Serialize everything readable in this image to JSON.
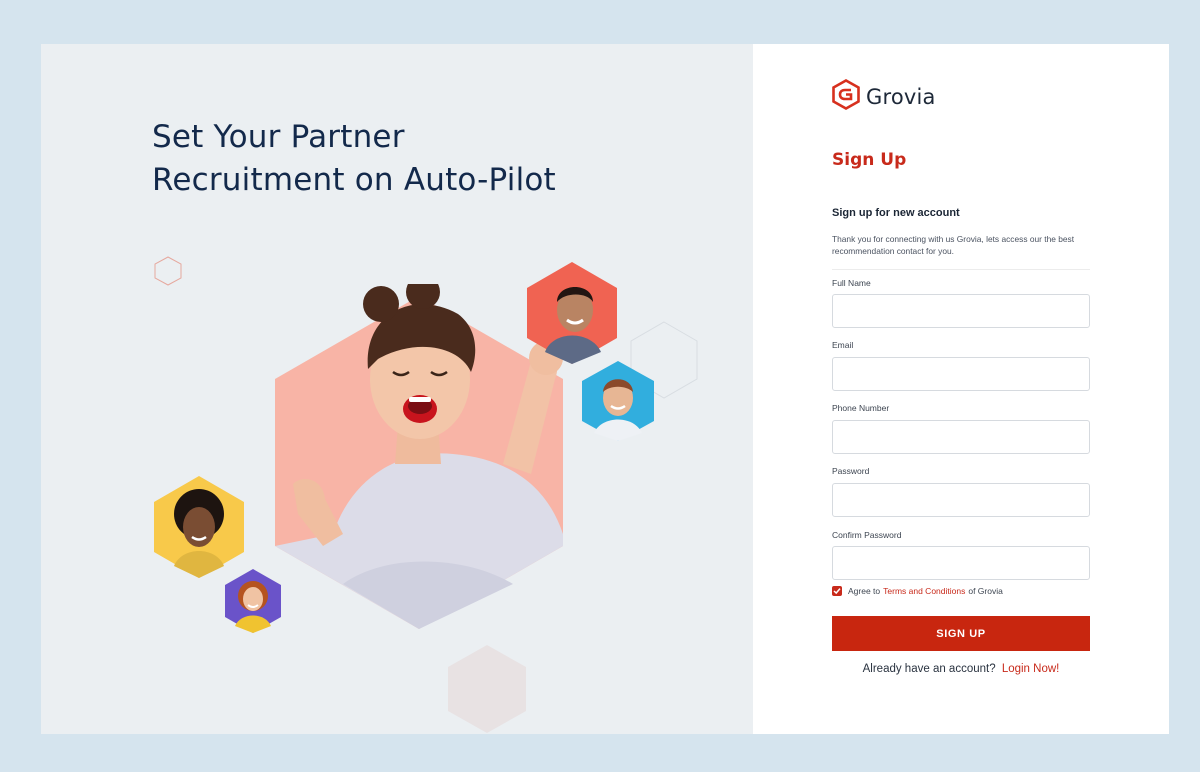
{
  "hero": {
    "headline_line1": "Set Your Partner",
    "headline_line2": "Recruitment on Auto-Pilot"
  },
  "brand": {
    "name": "Grovia",
    "accent_color": "#c82a1b",
    "logo_icon": "hexagon-logo-icon"
  },
  "form": {
    "title": "Sign Up",
    "subtitle": "Sign up for new account",
    "description": "Thank you for connecting with us Grovia, lets access our the best recommendation contact for you.",
    "fields": [
      {
        "label": "Full Name",
        "value": "",
        "placeholder": ""
      },
      {
        "label": "Email",
        "value": "",
        "placeholder": ""
      },
      {
        "label": "Phone Number",
        "value": "",
        "placeholder": ""
      },
      {
        "label": "Password",
        "value": "",
        "placeholder": ""
      },
      {
        "label": "Confirm Password",
        "value": "",
        "placeholder": ""
      }
    ],
    "agree_prefix": "Agree to",
    "agree_link": "Terms and Conditions",
    "agree_suffix": "of Grovia",
    "agree_checked": true,
    "submit_label": "SIGN UP",
    "login_prompt": "Already have an account?",
    "login_link": "Login Now!"
  },
  "colors": {
    "page_bg": "#d5e4ee",
    "hero_bg": "#ebeff2",
    "headline": "#13294b",
    "hex_salmon": "#f8b4a6",
    "hex_red": "#f06352",
    "hex_blue": "#31aede",
    "hex_yellow": "#f8c94a",
    "hex_purple": "#6a53c9"
  }
}
